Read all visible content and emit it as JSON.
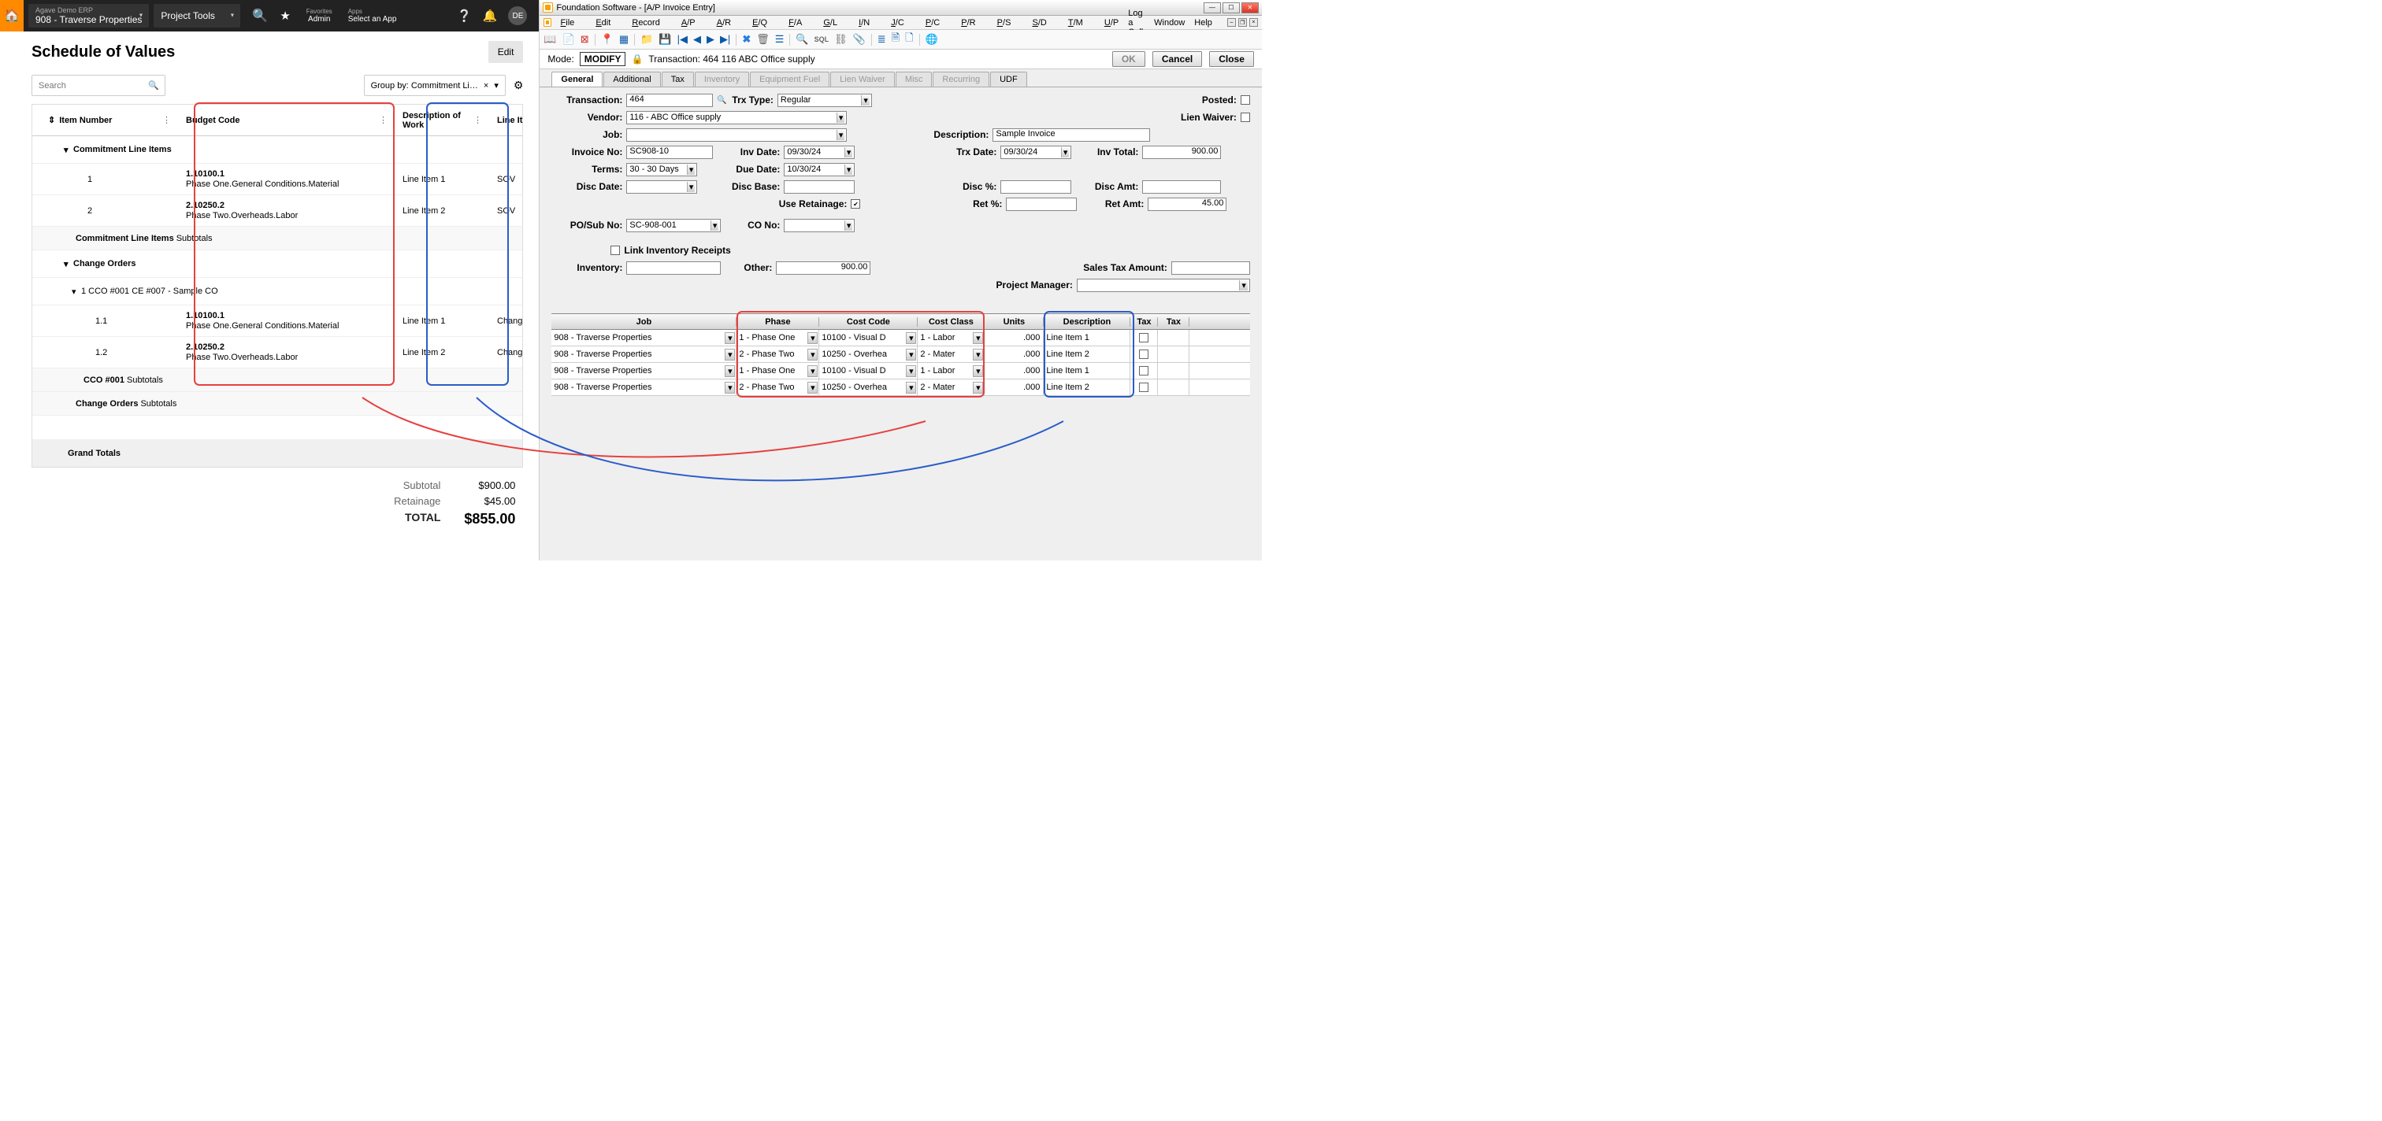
{
  "erp": {
    "topbar": {
      "erp_name": "Agave Demo ERP",
      "project": "908 - Traverse Properties",
      "tools": "Project Tools",
      "favorites_label": "Favorites",
      "admin": "Admin",
      "apps_label": "Apps",
      "select_app": "Select an App",
      "avatar": "DE"
    },
    "sov": {
      "title": "Schedule of Values",
      "edit": "Edit",
      "search_placeholder": "Search",
      "group_by": "Group by: Commitment Li…",
      "columns": {
        "item": "Item Number",
        "budget": "Budget Code",
        "desc": "Description of Work",
        "type": "Line It"
      },
      "sections": {
        "commitment": {
          "label": "Commitment Line Items",
          "rows": [
            {
              "item": "1",
              "code": "1.10100.1",
              "name": "Phase One.General Conditions.Material",
              "desc": "Line Item 1",
              "type": "SOV"
            },
            {
              "item": "2",
              "code": "2.10250.2",
              "name": "Phase Two.Overheads.Labor",
              "desc": "Line Item 2",
              "type": "SOV"
            }
          ],
          "subtotal_label": "Commitment Line Items",
          "subtotal_word": "Subtotals"
        },
        "change_orders": {
          "label": "Change Orders",
          "sub": "1 CCO #001 CE #007 - Sample CO",
          "rows": [
            {
              "item": "1.1",
              "code": "1.10100.1",
              "name": "Phase One.General Conditions.Material",
              "desc": "Line Item 1",
              "type": "Chang"
            },
            {
              "item": "1.2",
              "code": "2.10250.2",
              "name": "Phase Two.Overheads.Labor",
              "desc": "Line Item 2",
              "type": "Chang"
            }
          ],
          "subtotal_label": "CCO #001",
          "subtotal_word": "Subtotals",
          "outer_subtotal_label": "Change Orders",
          "outer_subtotal_word": "Subtotals"
        }
      },
      "grand": "Grand Totals",
      "totals": {
        "subtotal_label": "Subtotal",
        "subtotal": "$900.00",
        "retainage_label": "Retainage",
        "retainage": "$45.00",
        "total_label": "TOTAL",
        "total": "$855.00"
      }
    }
  },
  "fs": {
    "title": "Foundation Software - [A/P Invoice Entry]",
    "menus": [
      "File",
      "Edit",
      "Record",
      "A/P",
      "A/R",
      "E/Q",
      "F/A",
      "G/L",
      "I/N",
      "J/C",
      "P/C",
      "P/R",
      "P/S",
      "S/D",
      "T/M",
      "U/P"
    ],
    "menus_right": [
      "Log a Call",
      "Window",
      "Help"
    ],
    "mode_label": "Mode:",
    "mode": "MODIFY",
    "trx_label": "Transaction: 464   116  ABC Office supply",
    "btn_ok": "OK",
    "btn_cancel": "Cancel",
    "btn_close": "Close",
    "tabs": [
      {
        "label": "General",
        "active": true
      },
      {
        "label": "Additional"
      },
      {
        "label": "Tax"
      },
      {
        "label": "Inventory",
        "disabled": true
      },
      {
        "label": "Equipment Fuel",
        "disabled": true
      },
      {
        "label": "Lien Waiver",
        "disabled": true
      },
      {
        "label": "Misc",
        "disabled": true
      },
      {
        "label": "Recurring",
        "disabled": true
      },
      {
        "label": "UDF"
      }
    ],
    "form": {
      "transaction_label": "Transaction:",
      "transaction": "464",
      "trx_type_label": "Trx Type:",
      "trx_type": "Regular",
      "posted_label": "Posted:",
      "vendor_label": "Vendor:",
      "vendor": "116  - ABC Office supply",
      "lien_label": "Lien Waiver:",
      "job_label": "Job:",
      "description_label": "Description:",
      "description": "Sample Invoice",
      "invoice_no_label": "Invoice No:",
      "invoice_no": "SC908-10",
      "inv_date_label": "Inv Date:",
      "inv_date": "09/30/24",
      "trx_date_label": "Trx Date:",
      "trx_date": "09/30/24",
      "inv_total_label": "Inv Total:",
      "inv_total": "900.00",
      "terms_label": "Terms:",
      "terms": "30  - 30 Days",
      "due_date_label": "Due Date:",
      "due_date": "10/30/24",
      "disc_date_label": "Disc Date:",
      "disc_base_label": "Disc Base:",
      "disc_pct_label": "Disc %:",
      "disc_amt_label": "Disc Amt:",
      "use_retainage_label": "Use Retainage:",
      "use_retainage": true,
      "ret_pct_label": "Ret %:",
      "ret_amt_label": "Ret Amt:",
      "ret_amt": "45.00",
      "posub_label": "PO/Sub No:",
      "posub": "SC-908-001",
      "co_no_label": "CO No:",
      "link_inv_label": "Link Inventory Receipts",
      "inventory_label": "Inventory:",
      "other_label": "Other:",
      "other": "900.00",
      "sales_tax_label": "Sales Tax Amount:",
      "pm_label": "Project Manager:"
    },
    "grid": {
      "headers": {
        "job": "Job",
        "phase": "Phase",
        "cost": "Cost Code",
        "class": "Cost Class",
        "units": "Units",
        "desc": "Description",
        "tax1": "Tax",
        "tax2": "Tax"
      },
      "rows": [
        {
          "job": "908  - Traverse Properties",
          "phase": "1  - Phase One",
          "cost": "10100  - Visual D",
          "class": "1  - Labor",
          "units": ".000",
          "desc": "Line Item 1"
        },
        {
          "job": "908  - Traverse Properties",
          "phase": "2  - Phase Two",
          "cost": "10250  - Overhea",
          "class": "2  - Mater",
          "units": ".000",
          "desc": "Line Item 2"
        },
        {
          "job": "908  - Traverse Properties",
          "phase": "1  - Phase One",
          "cost": "10100  - Visual D",
          "class": "1  - Labor",
          "units": ".000",
          "desc": "Line Item 1"
        },
        {
          "job": "908  - Traverse Properties",
          "phase": "2  - Phase Two",
          "cost": "10250  - Overhea",
          "class": "2  - Mater",
          "units": ".000",
          "desc": "Line Item 2"
        }
      ]
    }
  }
}
